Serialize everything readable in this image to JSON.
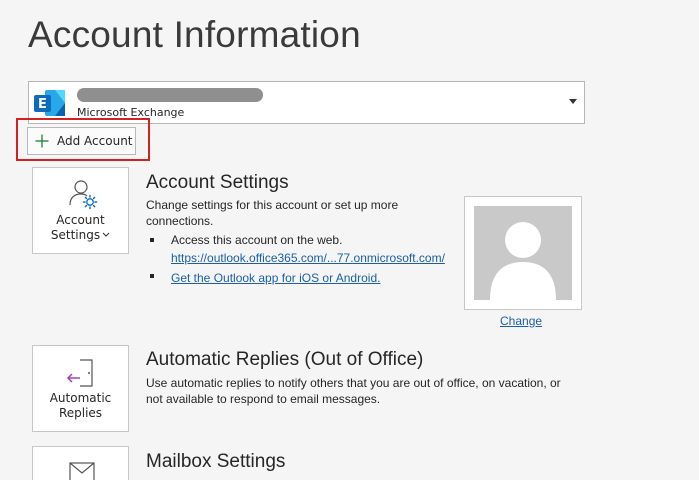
{
  "page": {
    "title": "Account Information"
  },
  "account": {
    "type_label": "Microsoft Exchange",
    "logo_letter": "E"
  },
  "add_account": {
    "label": "Add Account"
  },
  "account_settings": {
    "tile_label_line1": "Account",
    "tile_label_line2": "Settings",
    "title": "Account Settings",
    "description_line1": "Change settings for this account or set up more",
    "description_line2": "connections.",
    "bullet_web": "Access this account on the web.",
    "web_link": "https://outlook.office365.com/...77.onmicrosoft.com/",
    "mobile_link": "Get the Outlook app for iOS or Android.",
    "change_photo_label": "Change"
  },
  "automatic_replies": {
    "tile_label_line1": "Automatic",
    "tile_label_line2": "Replies",
    "title": "Automatic Replies (Out of Office)",
    "description_line1": "Use automatic replies to notify others that you are out of office, on vacation, or",
    "description_line2": "not available to respond to email messages."
  },
  "mailbox_settings": {
    "title": "Mailbox Settings"
  },
  "colors": {
    "accent_blue": "#0f6cbd",
    "link": "#1b5fa8",
    "highlight_red": "#d32020",
    "add_green": "#1e7d36"
  }
}
